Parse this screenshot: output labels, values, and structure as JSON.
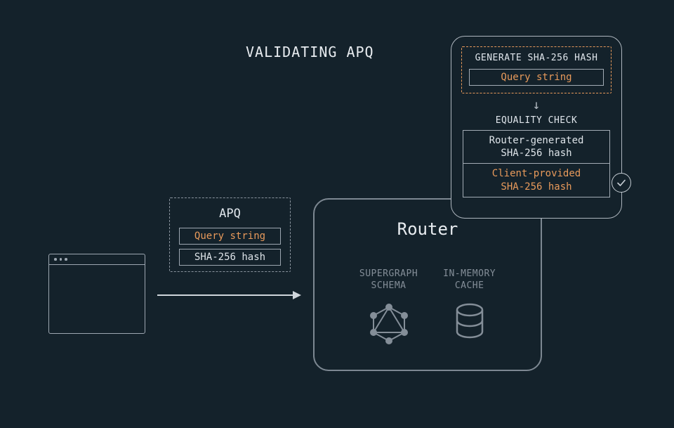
{
  "title": "VALIDATING APQ",
  "apq": {
    "label": "APQ",
    "query": "Query string",
    "hash": "SHA-256 hash"
  },
  "router": {
    "label": "Router",
    "supergraph_line1": "SUPERGRAPH",
    "supergraph_line2": "SCHEMA",
    "cache_line1": "IN-MEMORY",
    "cache_line2": "CACHE"
  },
  "validate": {
    "gen_title": "GENERATE SHA-256 HASH",
    "gen_item": "Query string",
    "eq_title": "EQUALITY CHECK",
    "eq_router_l1": "Router-generated",
    "eq_router_l2": "SHA-256 hash",
    "eq_client_l1": "Client-provided",
    "eq_client_l2": "SHA-256 hash"
  },
  "arrow_down": "↓"
}
